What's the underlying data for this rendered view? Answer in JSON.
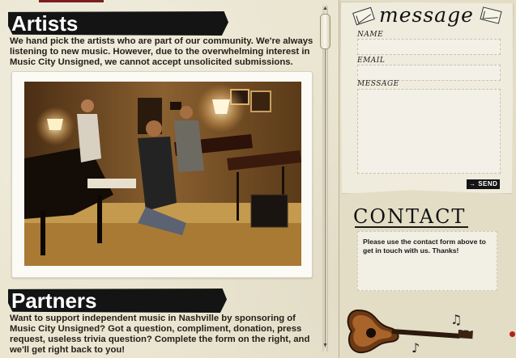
{
  "artists": {
    "heading": "Artists",
    "body": "We hand pick the artists who are part of our community. We're always listening to new music. However, due to the overwhelming interest in Music City Unsigned, we cannot accept unsolicited submissions."
  },
  "partners": {
    "heading": "Partners",
    "body": "Want to support independent music in Nashville by sponsoring of Music City Unsigned? Got a question, compliment, donation, press request, useless trivia question? Complete the form on the right, and we'll get right back to you!"
  },
  "message_form": {
    "title": "message",
    "name_label": "NAME",
    "email_label": "EMAIL",
    "message_label": "MESSAGE",
    "name_value": "",
    "email_value": "",
    "message_value": "",
    "send_label": "→ SEND"
  },
  "contact": {
    "title": "CONTACT",
    "text": "Please use the contact form above to get in touch with us. Thanks!"
  },
  "colors": {
    "heading_bar": "#141414",
    "paper": "#ebe6d2",
    "accent_red": "#b3201f"
  },
  "icons": [
    "envelope-icon",
    "scroll-up-arrow-icon",
    "scroll-down-arrow-icon",
    "guitar-icon",
    "music-note-icon"
  ]
}
